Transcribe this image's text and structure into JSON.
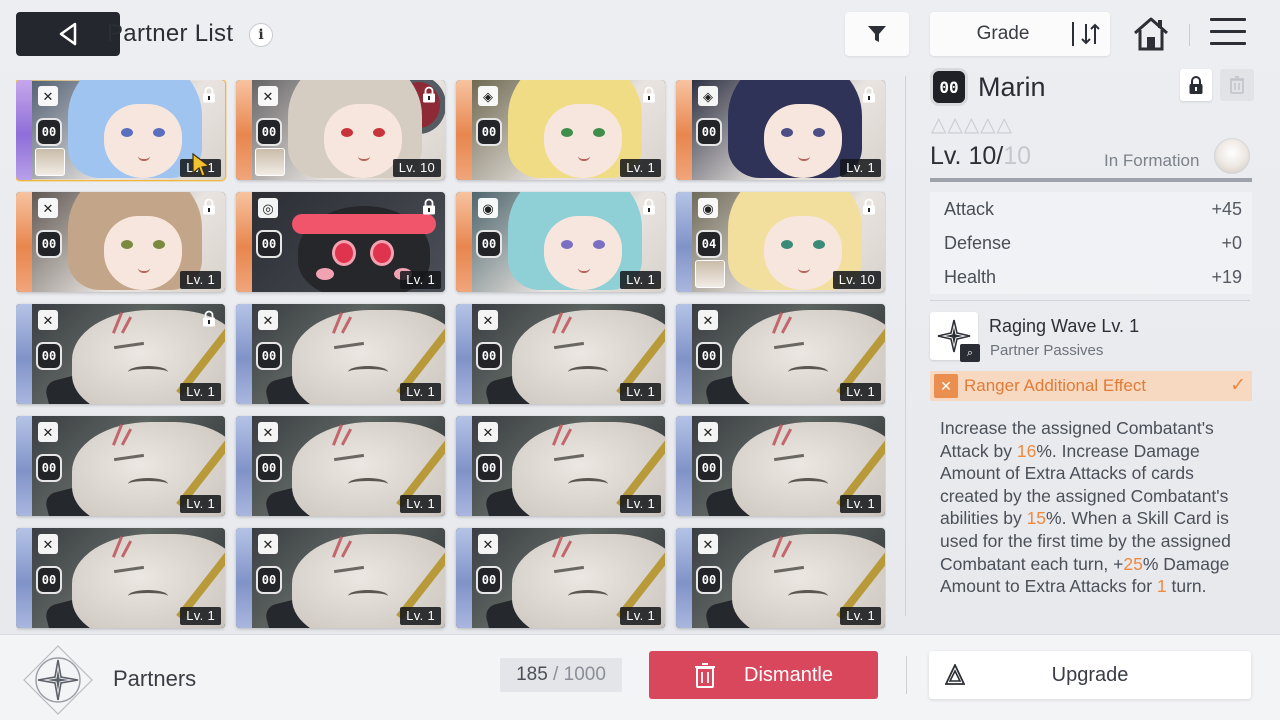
{
  "header": {
    "title": "Partner List",
    "sort_label": "Grade"
  },
  "cards": [
    {
      "variant": "girl",
      "stripe": "purple",
      "hair": "#9fc4f0",
      "eye": "#5a6fc0",
      "type_icon": "✕",
      "rank": "00",
      "level": "Lv. 1",
      "locked": true,
      "mini": true,
      "selected": true
    },
    {
      "variant": "girl",
      "stripe": "orange",
      "hair": "#d5ccc2",
      "eye": "#c7343c",
      "type_icon": "✕",
      "rank": "00",
      "level": "Lv. 10",
      "locked": true,
      "mini": true,
      "ring": true
    },
    {
      "variant": "girl",
      "stripe": "orange",
      "hair": "#f1dc86",
      "eye": "#3f8e4b",
      "type_icon": "◈",
      "rank": "00",
      "level": "Lv. 1",
      "locked": true
    },
    {
      "variant": "girl",
      "stripe": "orange",
      "hair": "#2f3358",
      "eye": "#4b4f86",
      "type_icon": "◈",
      "rank": "00",
      "level": "Lv. 1",
      "locked": true
    },
    {
      "variant": "girl",
      "stripe": "orange",
      "hair": "#c3a689",
      "eye": "#7a8a3e",
      "type_icon": "✕",
      "rank": "00",
      "level": "Lv. 1",
      "locked": true
    },
    {
      "variant": "mascot",
      "stripe": "orange",
      "type_icon": "◎",
      "rank": "00",
      "level": "Lv. 1",
      "locked": true
    },
    {
      "variant": "girl",
      "stripe": "orange",
      "hair": "#8fd0d6",
      "eye": "#7b6fc4",
      "type_icon": "◉",
      "rank": "00",
      "level": "Lv. 1",
      "locked": true
    },
    {
      "variant": "girl",
      "stripe": "blue",
      "hair": "#f2df9d",
      "eye": "#3c8a78",
      "type_icon": "◉",
      "rank": "04",
      "level": "Lv. 10",
      "locked": true,
      "mini": true
    },
    {
      "variant": "grunt",
      "stripe": "blue",
      "type_icon": "✕",
      "rank": "00",
      "level": "Lv. 1",
      "locked": true
    },
    {
      "variant": "grunt",
      "stripe": "blue",
      "type_icon": "✕",
      "rank": "00",
      "level": "Lv. 1"
    },
    {
      "variant": "grunt",
      "stripe": "blue",
      "type_icon": "✕",
      "rank": "00",
      "level": "Lv. 1"
    },
    {
      "variant": "grunt",
      "stripe": "blue",
      "type_icon": "✕",
      "rank": "00",
      "level": "Lv. 1"
    },
    {
      "variant": "grunt",
      "stripe": "blue",
      "type_icon": "✕",
      "rank": "00",
      "level": "Lv. 1"
    },
    {
      "variant": "grunt",
      "stripe": "blue",
      "type_icon": "✕",
      "rank": "00",
      "level": "Lv. 1"
    },
    {
      "variant": "grunt",
      "stripe": "blue",
      "type_icon": "✕",
      "rank": "00",
      "level": "Lv. 1"
    },
    {
      "variant": "grunt",
      "stripe": "blue",
      "type_icon": "✕",
      "rank": "00",
      "level": "Lv. 1"
    },
    {
      "variant": "grunt",
      "stripe": "blue",
      "type_icon": "✕",
      "rank": "00",
      "level": "Lv. 1"
    },
    {
      "variant": "grunt",
      "stripe": "blue",
      "type_icon": "✕",
      "rank": "00",
      "level": "Lv. 1"
    },
    {
      "variant": "grunt",
      "stripe": "blue",
      "type_icon": "✕",
      "rank": "00",
      "level": "Lv. 1"
    },
    {
      "variant": "grunt",
      "stripe": "blue",
      "type_icon": "✕",
      "rank": "00",
      "level": "Lv. 1"
    }
  ],
  "partner": {
    "rank": "00",
    "name": "Marin",
    "stars": "△△△△△",
    "level": "Lv. 10/",
    "level_max": "10",
    "level_fraction": 1.0,
    "formation": "In Formation",
    "stats": [
      {
        "label": "Attack",
        "value": "+45"
      },
      {
        "label": "Defense",
        "value": "+0"
      },
      {
        "label": "Health",
        "value": "+19"
      }
    ],
    "skill_name": "Raging Wave Lv. 1",
    "skill_type": "Partner Passives",
    "effect_label": "Ranger Additional Effect",
    "effect_check": "✓",
    "desc": [
      {
        "t": "Increase the assigned Combatant's Attack by "
      },
      {
        "t": "16",
        "hl": true
      },
      {
        "t": "%. Increase Damage Amount of Extra Attacks of cards created by the assigned Combatant's abilities by "
      },
      {
        "t": "15",
        "hl": true
      },
      {
        "t": "%. When a Skill Card is used for the first time by the assigned Combatant each turn, +"
      },
      {
        "t": "25",
        "hl": true
      },
      {
        "t": "% Damage Amount to Extra Attacks for "
      },
      {
        "t": "1",
        "hl": true
      },
      {
        "t": " turn."
      }
    ]
  },
  "footer": {
    "label": "Partners",
    "count": "185",
    "count_sep": " / ",
    "count_total": "1000",
    "dismantle": "Dismantle",
    "upgrade": "Upgrade"
  },
  "colors": {
    "accent_orange": "#ee8a3f",
    "dismantle_red": "#d8475c",
    "selected_border": "#f0b73e"
  }
}
